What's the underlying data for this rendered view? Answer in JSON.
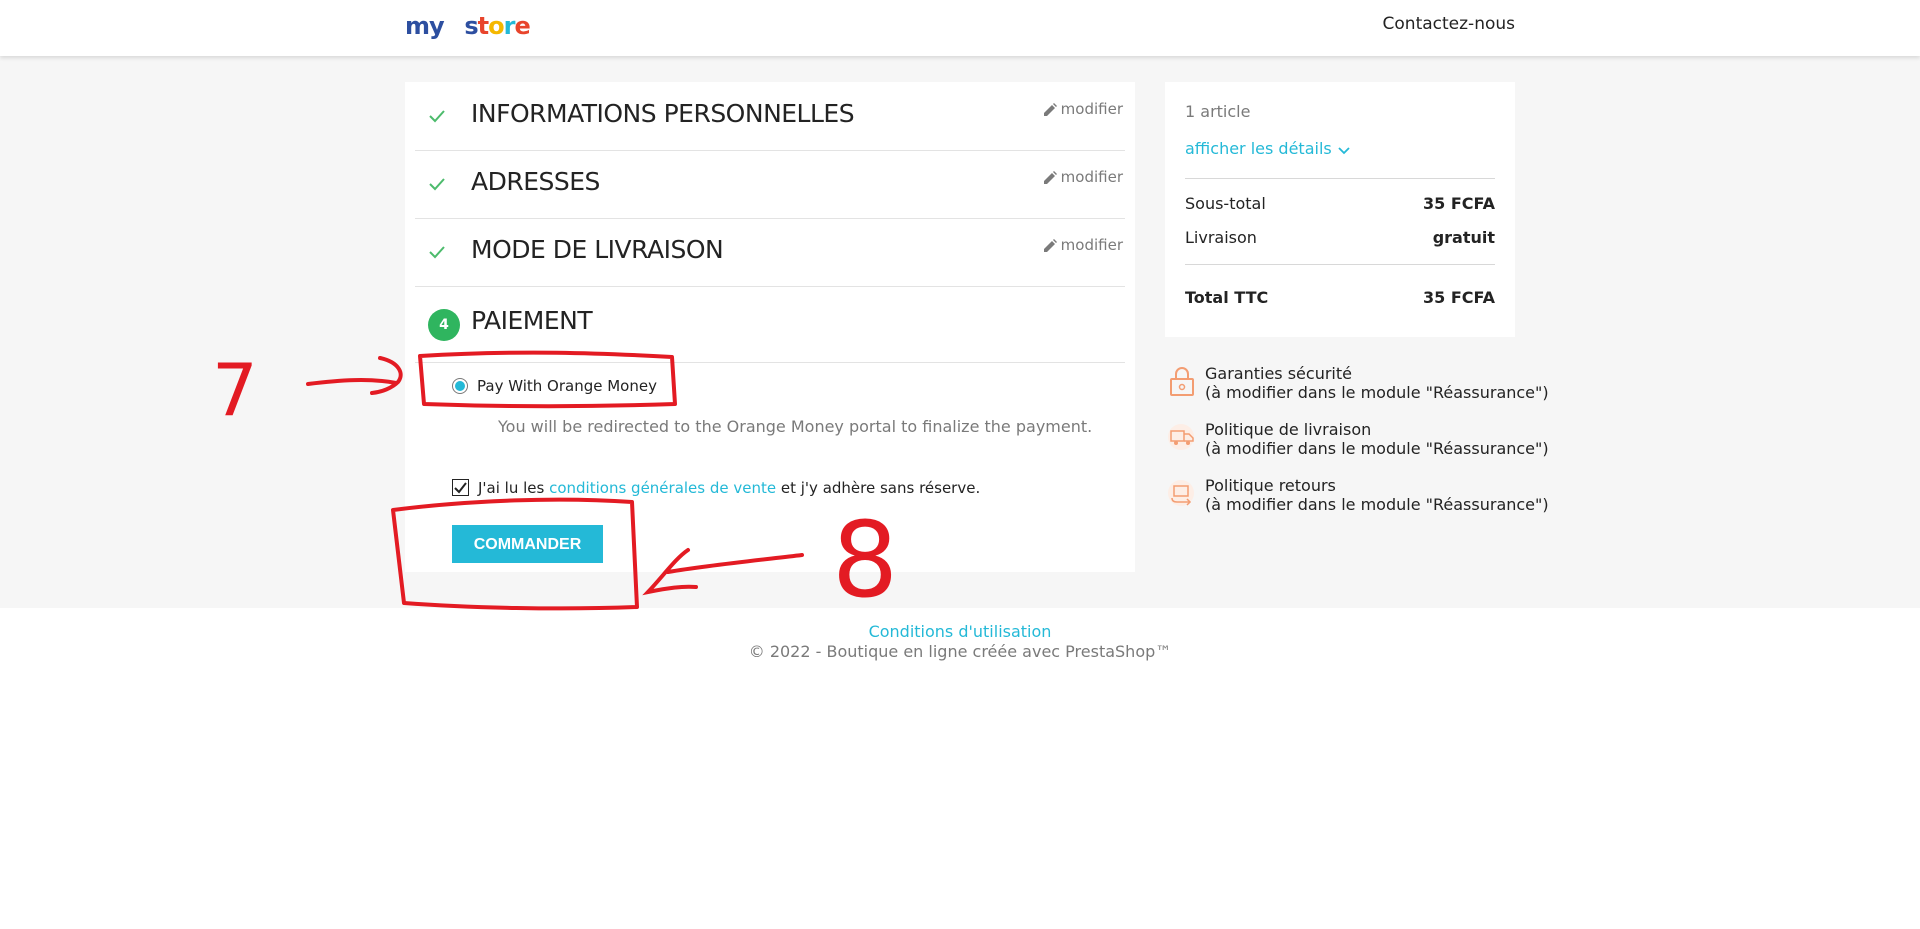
{
  "header": {
    "logo": {
      "my": "my",
      "store_s": "s",
      "store_t": "t",
      "store_o": "o",
      "store_r": "r",
      "store_e": "e"
    },
    "contact": "Contactez-nous"
  },
  "checkout": {
    "steps": [
      {
        "title": "INFORMATIONS PERSONNELLES",
        "edit": "modifier"
      },
      {
        "title": "ADRESSES",
        "edit": "modifier"
      },
      {
        "title": "MODE DE LIVRAISON",
        "edit": "modifier"
      }
    ],
    "payment": {
      "number": "4",
      "title": "PAIEMENT",
      "option_label": "Pay With Orange Money",
      "option_note": "You will be redirected to the Orange Money portal to finalize the payment.",
      "terms_prefix": "J'ai lu les ",
      "terms_link": "conditions générales de vente",
      "terms_suffix": " et j'y adhère sans réserve.",
      "order_button": "COMMANDER"
    }
  },
  "summary": {
    "articles": "1 article",
    "details_link": "afficher les détails",
    "subtotal_label": "Sous-total",
    "subtotal_value": "35 FCFA",
    "shipping_label": "Livraison",
    "shipping_value": "gratuit",
    "total_label": "Total TTC",
    "total_value": "35 FCFA"
  },
  "reassurance": [
    {
      "title": "Garanties sécurité",
      "note": "(à modifier dans le module \"Réassurance\")",
      "icon": "lock-icon"
    },
    {
      "title": "Politique de livraison",
      "note": "(à modifier dans le module \"Réassurance\")",
      "icon": "truck-icon"
    },
    {
      "title": "Politique retours",
      "note": "(à modifier dans le module \"Réassurance\")",
      "icon": "return-icon"
    }
  ],
  "footer": {
    "terms_link": "Conditions d'utilisation",
    "copyright": "© 2022 - Boutique en ligne créée avec PrestaShop™"
  },
  "annotations": {
    "label7": "7",
    "label8": "8"
  },
  "colors": {
    "accent": "#24b9d7",
    "success": "#2fb55f",
    "annotation": "#e31b23",
    "reassurance_icon": "#f39d72"
  }
}
